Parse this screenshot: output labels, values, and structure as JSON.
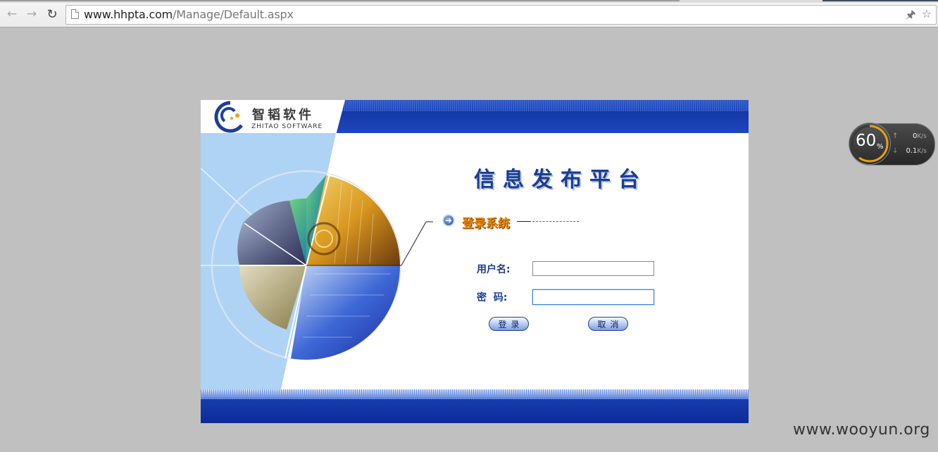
{
  "browser": {
    "url_host": "www.hhpta.com",
    "url_path": "/Manage/Default.aspx",
    "icons": [
      "back-icon",
      "forward-icon",
      "reload-icon",
      "page-icon",
      "pin-icon",
      "star-icon"
    ]
  },
  "panel": {
    "logo_cn": "智韬软件",
    "logo_en": "ZHITAO SOFTWARE",
    "platform_title": "信息发布平台",
    "section_title": "登录系统",
    "username_label": "用户名:",
    "password_label": "密  码:",
    "username_value": "",
    "password_value": "",
    "login_button": "登录",
    "cancel_button": "取消"
  },
  "net_widget": {
    "percent": "60",
    "percent_sign": "%",
    "upload_value": "0",
    "upload_unit": "K/s",
    "download_value": "0.1",
    "download_unit": "K/s",
    "level": 0.6
  },
  "watermark": "www.wooyun.org",
  "colors": {
    "background": "#c0c0c0",
    "panel_blue": "#1d47bc",
    "title_blue": "#1a3d94",
    "section_orange": "#e8860c"
  }
}
